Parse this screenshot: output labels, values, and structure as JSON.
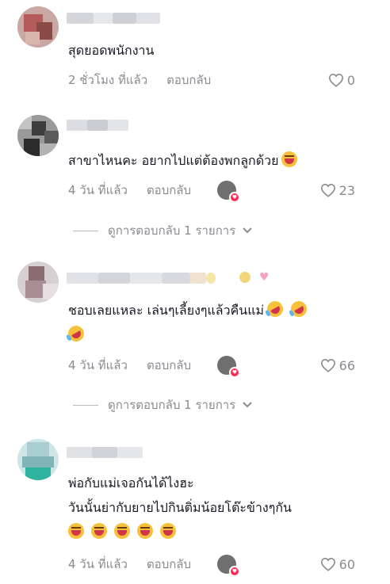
{
  "comments": [
    {
      "text_lines": [
        "สุดยอดพนักงาน"
      ],
      "time": "2 ชั่วโมง ที่แล้ว",
      "reply_label": "ตอบกลับ",
      "likes": "0",
      "creator_liked": false,
      "emoji": []
    },
    {
      "text_lines": [
        "สาขาไหนคะ อยากไปแต่ต้องพกลูกด้วย"
      ],
      "time": "4 วัน ที่แล้ว",
      "reply_label": "ตอบกลับ",
      "likes": "23",
      "creator_liked": true,
      "emoji": [
        "grinning-squinting-face"
      ],
      "view_replies": "ดูการตอบกลับ 1 รายการ"
    },
    {
      "text_lines": [
        "ชอบเลยแหละ เล่นๆเลี้ยงๆแล้วคืนแม่"
      ],
      "time": "4 วัน ที่แล้ว",
      "reply_label": "ตอบกลับ",
      "likes": "66",
      "creator_liked": true,
      "emoji": [
        "rolling-on-floor-laughing"
      ],
      "view_replies": "ดูการตอบกลับ 1 รายการ"
    },
    {
      "text_lines": [
        "พ่อกับแม่เจอกันได้ไงฮะ",
        "วันนั้นย่ากับยายไปกินติ่มน้อยโต๊ะข้างๆกัน"
      ],
      "time": "4 วัน ที่แล้ว",
      "reply_label": "ตอบกลับ",
      "likes": "60",
      "creator_liked": true,
      "emoji": [
        "grinning-squinting-face"
      ]
    }
  ],
  "colors": {
    "text": "#161823",
    "muted": "#8a8b91",
    "heart_badge": "#fe2c55"
  }
}
